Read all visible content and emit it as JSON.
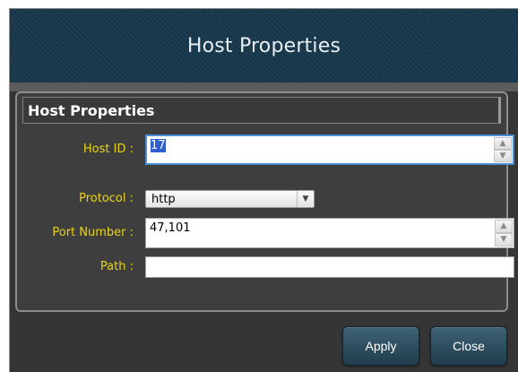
{
  "window": {
    "title": "Host Properties"
  },
  "group": {
    "title": "Host Properties"
  },
  "fields": {
    "host_id": {
      "label": "Host ID :",
      "value": "17"
    },
    "protocol": {
      "label": "Protocol :",
      "value": "http"
    },
    "port_number": {
      "label": "Port Number :",
      "value": "47,101"
    },
    "path": {
      "label": "Path :",
      "value": ""
    }
  },
  "buttons": {
    "apply": "Apply",
    "close": "Close"
  },
  "icons": {
    "spin_up": "chevron-up-icon",
    "spin_down": "chevron-down-icon",
    "dropdown": "chevron-down-icon"
  },
  "colors": {
    "title_bar": "#17374a",
    "dialog_bg": "#353535",
    "label_text": "#e9d41a",
    "focus_border": "#4a8fd6",
    "button_bg": "#2c4b5c"
  }
}
